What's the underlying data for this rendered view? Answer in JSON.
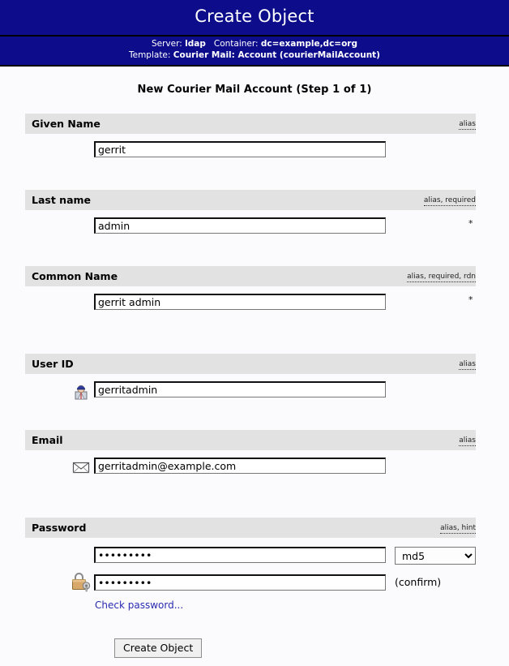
{
  "window": {
    "title": "Create Object"
  },
  "context": {
    "server_label": "Server:",
    "server_value": "ldap",
    "container_label": "Container:",
    "container_value": "dc=example,dc=org",
    "template_label": "Template:",
    "template_value": "Courier Mail: Account (courierMailAccount)"
  },
  "page": {
    "heading": "New Courier Mail Account (Step 1 of 1)"
  },
  "fields": [
    {
      "name": "Given Name",
      "flags": "alias",
      "value": "gerrit",
      "required_marker": "",
      "icon": ""
    },
    {
      "name": "Last name",
      "flags": "alias, required",
      "value": "admin",
      "required_marker": "*",
      "icon": ""
    },
    {
      "name": "Common Name",
      "flags": "alias, required, rdn",
      "value": "gerrit admin",
      "required_marker": "*",
      "icon": ""
    },
    {
      "name": "User ID",
      "flags": "alias",
      "value": "gerritadmin",
      "required_marker": "",
      "icon": "user-icon"
    },
    {
      "name": "Email",
      "flags": "alias",
      "value": "gerritadmin@example.com",
      "required_marker": "",
      "icon": "envelope-icon"
    }
  ],
  "password": {
    "name": "Password",
    "flags": "alias, hint",
    "icon": "padlock-key-icon",
    "value": "•••••••••",
    "confirm_value": "•••••••••",
    "hash_selected": "md5",
    "hash_options": [
      "md5"
    ],
    "confirm_label": "(confirm)",
    "check_link": "Check password..."
  },
  "actions": {
    "submit_label": "Create Object"
  },
  "colors": {
    "titlebar_blue": "#0d0d8c",
    "attr_header_gray": "#e2e2e2",
    "link_blue": "#2a2ab0",
    "page_background": "#fbfbfd"
  }
}
